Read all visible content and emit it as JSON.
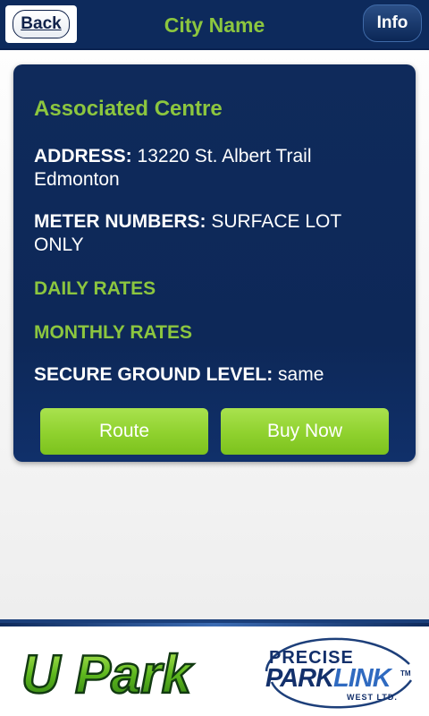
{
  "header": {
    "back_label": "Back",
    "title": "City Name",
    "info_label": "Info"
  },
  "card": {
    "title": "Associated Centre",
    "address_label": "ADDRESS:",
    "address_value": "13220 St. Albert Trail Edmonton",
    "meter_label": "METER NUMBERS:",
    "meter_value": "SURFACE LOT ONLY",
    "daily_rates": "DAILY RATES",
    "monthly_rates": "MONTHLY RATES",
    "secure_label": "SECURE GROUND LEVEL:",
    "secure_value": "same",
    "route_button": "Route",
    "buy_button": "Buy Now"
  },
  "footer": {
    "upark_logo": "U Park",
    "precise_word": "PRECISE",
    "park_word": "PARK",
    "link_word": "LINK",
    "tm": "TM",
    "west_word": "WEST LTD."
  },
  "colors": {
    "header_bg": "#0d2a5c",
    "accent_green": "#8cc63f",
    "card_bg": "#0f2a5b",
    "button_green": "#8fd12e"
  }
}
